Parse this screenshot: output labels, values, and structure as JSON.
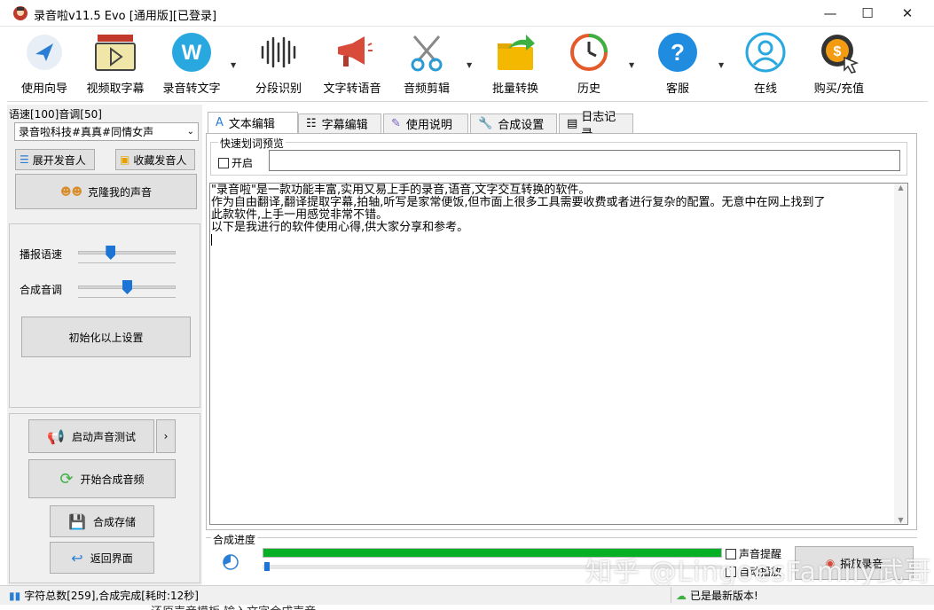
{
  "window": {
    "title": "录音啦v11.5 Evo [通用版][已登录]",
    "controls": {
      "minimize": "—",
      "maximize": "☐",
      "close": "✕"
    }
  },
  "toolbar": {
    "items": [
      {
        "label": "使用向导",
        "icon": "navigation-arrow-icon"
      },
      {
        "label": "视频取字幕",
        "icon": "video-subtitle-icon"
      },
      {
        "label": "录音转文字",
        "icon": "w-logo-icon"
      },
      {
        "label": "分段识别",
        "icon": "waveform-icon"
      },
      {
        "label": "文字转语音",
        "icon": "megaphone-icon"
      },
      {
        "label": "音频剪辑",
        "icon": "scissors-icon"
      },
      {
        "label": "批量转换",
        "icon": "folder-arrow-icon"
      },
      {
        "label": "历史",
        "icon": "history-clock-icon"
      },
      {
        "label": "客服",
        "icon": "help-question-icon"
      },
      {
        "label": "在线",
        "icon": "user-online-icon"
      },
      {
        "label": "购买/充值",
        "icon": "purchase-dollar-icon"
      }
    ]
  },
  "left": {
    "speed_pitch": "语速[100]音调[50]",
    "voice_selected": "录音啦科技#真真#同情女声",
    "expand_voices": "展开发音人",
    "favorite_voices": "收藏发音人",
    "clone_voice": "克隆我的声音",
    "broadcast_speed": "播报语速",
    "synth_pitch": "合成音调",
    "speed_level": 0.33,
    "pitch_level": 0.5,
    "reset_settings": "初始化以上设置",
    "start_voice_test": "启动声音测试",
    "more": "›",
    "start_synthesis": "开始合成音频",
    "save_synthesis": "合成存储",
    "return_ui": "返回界面"
  },
  "tabs": [
    {
      "label": "文本编辑",
      "icon": "text-edit-icon"
    },
    {
      "label": "字幕编辑",
      "icon": "list-icon"
    },
    {
      "label": "使用说明",
      "icon": "document-edit-icon"
    },
    {
      "label": "合成设置",
      "icon": "wrench-icon"
    },
    {
      "label": "日志记录",
      "icon": "log-icon"
    }
  ],
  "editor": {
    "quick_preview_label": "快速划词预览",
    "enable_label": "开启",
    "preview_value": "",
    "lines": [
      "\"录音啦\"是一款功能丰富,实用又易上手的录音,语音,文字交互转换的软件。",
      "作为自由翻译,翻译提取字幕,拍轴,听写是家常便饭,但市面上很多工具需要收费或者进行复杂的配置。无意中在网上找到了",
      "此款软件,上手一用感觉非常不错。",
      "以下是我进行的软件使用心得,供大家分享和参考。"
    ]
  },
  "synthesis": {
    "label": "合成进度",
    "progress": 1.0,
    "sound_reminder": "声音提醒",
    "auto_play": "自动播放",
    "play_button": "播放录音"
  },
  "status": {
    "left": "字符总数[259],合成完成[耗时:12秒]",
    "right": "已是最新版本!"
  },
  "watermark": "知乎 @LingoesFamily武哥",
  "bottom_text": "还原声音模板 输入文字合成声音。"
}
